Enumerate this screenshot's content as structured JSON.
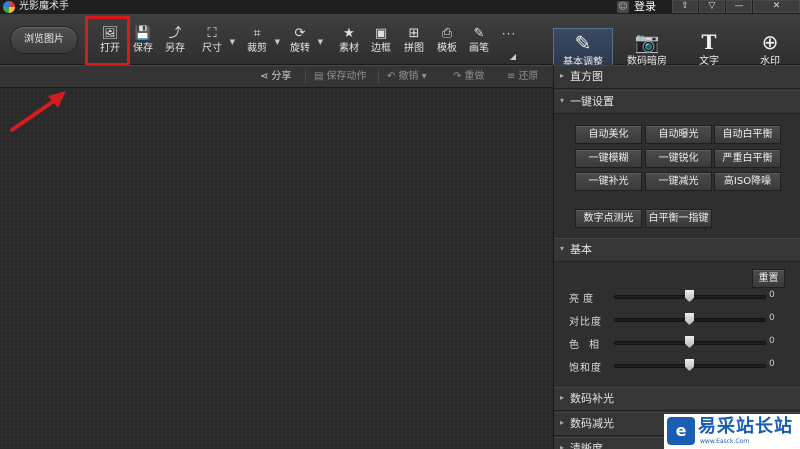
{
  "app": {
    "title": "光影魔术手",
    "login": "登录",
    "window_controls": [
      "⇧",
      "▽",
      "—",
      "✕"
    ]
  },
  "toolbar": {
    "browse": "浏览图片",
    "tools": [
      {
        "label": "打开",
        "icon": "open-image-icon",
        "glyph": "🖼"
      },
      {
        "label": "保存",
        "icon": "save-icon",
        "glyph": "💾"
      },
      {
        "label": "另存",
        "icon": "save-as-icon",
        "glyph": "⤴"
      },
      {
        "label": "尺寸",
        "icon": "resize-icon",
        "glyph": "⛶"
      },
      {
        "label": "裁剪",
        "icon": "crop-icon",
        "glyph": "⌗"
      },
      {
        "label": "旋转",
        "icon": "rotate-icon",
        "glyph": "⟳"
      },
      {
        "label": "素材",
        "icon": "material-icon",
        "glyph": "★"
      },
      {
        "label": "边框",
        "icon": "frame-icon",
        "glyph": "▣"
      },
      {
        "label": "拼图",
        "icon": "collage-icon",
        "glyph": "⊞"
      },
      {
        "label": "模板",
        "icon": "template-icon",
        "glyph": "⎙"
      },
      {
        "label": "画笔",
        "icon": "brush-icon",
        "glyph": "✎"
      }
    ],
    "more": "···"
  },
  "right_tabs": [
    {
      "label": "基本调整",
      "icon": "adjust-icon",
      "glyph": "✎",
      "active": true
    },
    {
      "label": "数码暗房",
      "icon": "darkroom-icon",
      "glyph": "📷",
      "active": false
    },
    {
      "label": "文字",
      "icon": "text-icon",
      "glyph": "T",
      "active": false
    },
    {
      "label": "水印",
      "icon": "watermark-icon",
      "glyph": "⊕",
      "active": false
    }
  ],
  "subbar": {
    "share": "分享",
    "save_action": "保存动作",
    "undo": "撤销",
    "redo": "重做",
    "restore": "还原"
  },
  "panel": {
    "histogram": "直方图",
    "one_click": "一键设置",
    "one_click_buttons": [
      "自动美化",
      "自动曝光",
      "自动白平衡",
      "一键模糊",
      "一键锐化",
      "严重白平衡",
      "一键补光",
      "一键减光",
      "高ISO降噪"
    ],
    "extra_buttons": [
      "数字点测光",
      "白平衡一指键"
    ],
    "basic": "基本",
    "reset": "重置",
    "sliders": [
      {
        "label": "亮度",
        "value": "0"
      },
      {
        "label": "对比度",
        "value": "0"
      },
      {
        "label": "色相",
        "value": "0"
      },
      {
        "label": "饱和度",
        "value": "0"
      }
    ],
    "digital_fill": "数码补光",
    "digital_reduce": "数码减光",
    "sharpness": "清晰度"
  },
  "watermark": {
    "text": "易采站长站",
    "url": "www.Easck.Com"
  },
  "colors": {
    "highlight": "#d41d1d",
    "active_tab": "#3a4a63",
    "brand": "#1a5db3"
  }
}
